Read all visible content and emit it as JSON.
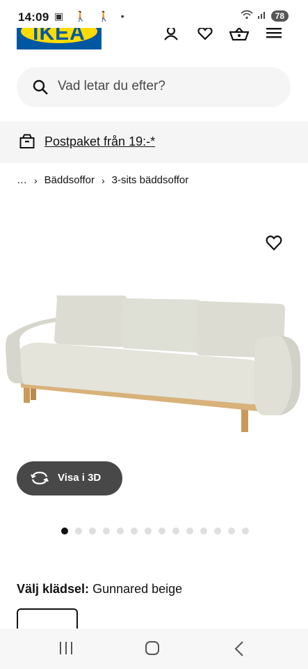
{
  "status_bar": {
    "time": "14:09",
    "battery": "78"
  },
  "header": {
    "logo": "IKEA",
    "icons": [
      "user-icon",
      "heart-icon",
      "basket-icon",
      "menu-icon"
    ]
  },
  "search": {
    "placeholder": "Vad letar du efter?"
  },
  "promo": {
    "text": "Postpaket från 19:-*"
  },
  "breadcrumb": {
    "items": [
      "…",
      "Bäddsoffor",
      "3-sits bäddsoffor"
    ]
  },
  "product": {
    "view_3d_label": "Visa i 3D",
    "image_count": 14,
    "active_image": 1
  },
  "options": {
    "label": "Välj klädsel:",
    "value": "Gunnared beige"
  },
  "colors": {
    "accent_dark": "#484848",
    "ikea_blue": "#0058a3",
    "ikea_yellow": "#ffdb00"
  }
}
